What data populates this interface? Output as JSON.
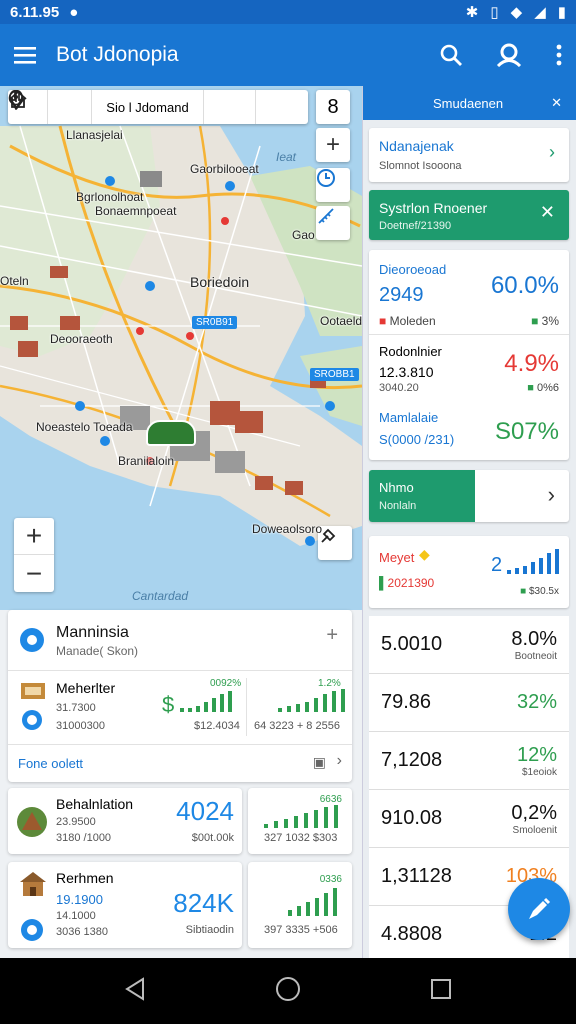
{
  "status": {
    "time": "6.11.95"
  },
  "appbar": {
    "title": "Bot Jdonopia"
  },
  "map": {
    "toolbar": {
      "location": "Sio l Jdomand",
      "count": "8"
    },
    "labels": [
      "Llanasjelai",
      "Gaorbilooeat",
      "Bgrlonolhoat",
      "Bonaemnpoeat",
      "Boriedoin",
      "Oteln",
      "Gao",
      "Ootaeldnir",
      "Deooraeoth",
      "Noeastelo Toeada",
      "Braniialoin",
      "Doweaolsoro",
      "Cantardad"
    ],
    "water_label": "Ieat",
    "badge": "SR0B91",
    "badge2": "SROBB1"
  },
  "card1": {
    "title": "Manninsia",
    "subtitle": "Manade( Skon)",
    "row_title": "Meherlter",
    "row_value": "31.7300",
    "row_sub": "31000300",
    "chart1_pct": "0092%",
    "chart1_value": "$",
    "chart1_foot": "$12.4034",
    "chart2_pct": "1.2%",
    "chart2_foot": "64 3223 + 8 2556",
    "footer_link": "Fone oolett"
  },
  "card2": {
    "title": "Behalnlation",
    "line1": "23.9500",
    "line2": "3180 /1000",
    "big": "4024",
    "big_sub": "$00t.00k",
    "chart_pct": "6636",
    "chart_foot": "327 1032 $303"
  },
  "card3": {
    "title": "Rerhmen",
    "line1": "19.1900",
    "line2": "14.1000",
    "line3": "3036 1380",
    "big": "824K",
    "big_sub": "Sibtiaodin",
    "chart_pct": "0336",
    "chart_foot": "397 3335 +506"
  },
  "rpanel": {
    "header": "Smudaenen",
    "item1_title": "Ndanajenak",
    "item1_sub": "Slomnot Isooona",
    "item2_title": "Systrlon Rnoener",
    "item2_sub": "Doetnef/21390",
    "metric1_label": "Dieoroeoad",
    "metric1_value": "2949",
    "metric1_pct": "60.0%",
    "metric1_foot_left": "Moleden",
    "metric1_foot_right": "3%",
    "metric2_label": "Rodonlnier",
    "metric2_value": "12.3.810",
    "metric2_sub": "3040.20",
    "metric2_pct": "4.9%",
    "metric2_foot_right": "0%6",
    "metric3_label": "Mamlalaie",
    "metric3_value": "S(0000 /231)",
    "metric3_pct": "S07%",
    "item3_title": "Nhmo",
    "item3_sub": "Nonlaln",
    "item4_title": "Meyet",
    "item4_value": "2021390",
    "item4_right": "2",
    "item4_foot": "$30.5x"
  },
  "rtable": [
    {
      "a": "5.0010",
      "b": "8.0%",
      "c": "Bootneoit",
      "color": "#111111"
    },
    {
      "a": "79.86",
      "b": "32%",
      "c": "",
      "color": "#2e9e4f"
    },
    {
      "a": "7,1208",
      "b": "12%",
      "c": "$1eoiok",
      "color": "#2e9e4f"
    },
    {
      "a": "910.08",
      "b": "0,2%",
      "c": "Smoloenit",
      "color": "#111111"
    },
    {
      "a": "1,31128",
      "b": "103%",
      "c": "",
      "color": "#f08020"
    },
    {
      "a": "4.8808",
      "b": "1.2",
      "c": "",
      "color": "#111111"
    }
  ],
  "colors": {
    "primary": "#1976d2",
    "accent": "#1e88e5",
    "green": "#2e9e4f",
    "teal": "#1e9b6e",
    "red": "#e53935"
  }
}
